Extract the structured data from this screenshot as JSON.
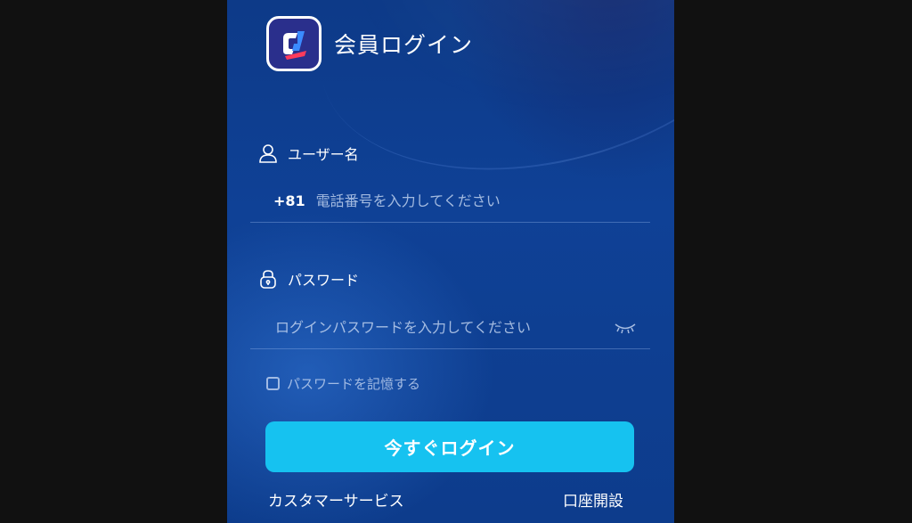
{
  "header": {
    "title": "会員ログイン",
    "logo_icon": "app-logo"
  },
  "username": {
    "label": "ユーザー名",
    "icon": "user-icon",
    "country_code": "+81",
    "placeholder": "電話番号を入力してください",
    "value": ""
  },
  "password": {
    "label": "パスワード",
    "icon": "lock-icon",
    "placeholder": "ログインパスワードを入力してください",
    "value": "",
    "toggle_icon": "eye-closed-icon"
  },
  "remember": {
    "label": "パスワードを記憶する",
    "checked": false
  },
  "login_button": {
    "label": "今すぐログイン",
    "color": "#16c2f0"
  },
  "footer": {
    "support_label": "カスタマーサービス",
    "register_label": "口座開設"
  }
}
